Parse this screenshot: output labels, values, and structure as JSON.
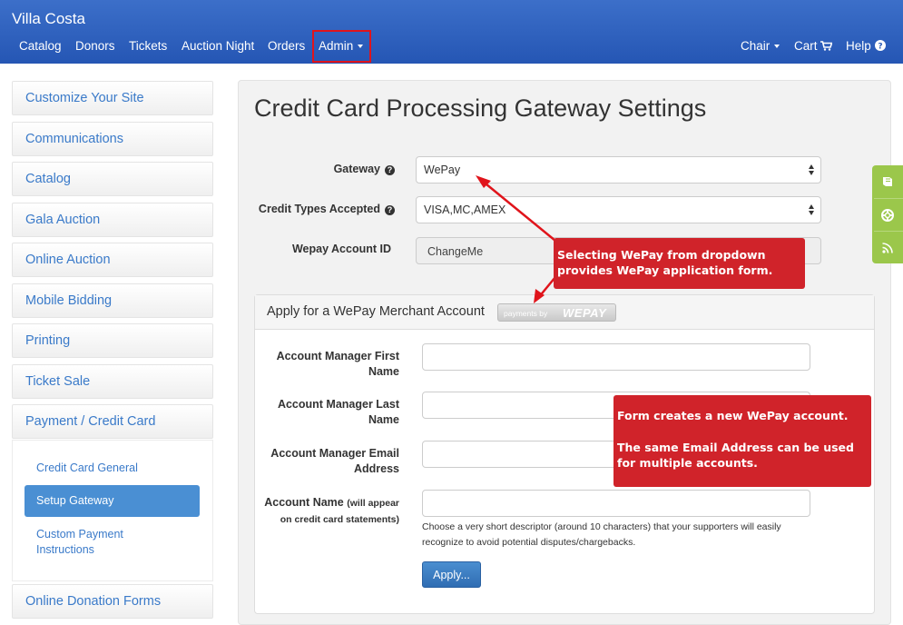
{
  "navbar": {
    "brand": "Villa Costa",
    "left_items": [
      "Catalog",
      "Donors",
      "Tickets",
      "Auction Night",
      "Orders",
      "Admin"
    ],
    "right_items": [
      "Chair",
      "Cart",
      "Help"
    ],
    "highlighted_item": "Admin",
    "colors": {
      "bar": "#2a5cb8",
      "highlight_box": "#e0141b"
    }
  },
  "sidebar": {
    "items": [
      "Customize Your Site",
      "Communications",
      "Catalog",
      "Gala Auction",
      "Online Auction",
      "Mobile Bidding",
      "Printing",
      "Ticket Sale",
      "Payment / Credit Card"
    ],
    "subitems": [
      "Credit Card General",
      "Setup Gateway",
      "Custom Payment Instructions"
    ],
    "active_subitem": "Setup Gateway",
    "after_items": [
      "Online Donation Forms"
    ]
  },
  "main": {
    "title": "Credit Card Processing Gateway Settings",
    "gateway_label": "Gateway",
    "gateway_value": "WePay",
    "credit_types_label": "Credit Types Accepted",
    "credit_types_value": "VISA,MC,AMEX",
    "account_id_label": "Wepay Account ID",
    "account_id_value": "ChangeMe"
  },
  "wepay": {
    "panel_title": "Apply for a WePay Merchant Account",
    "badge_small": "payments by",
    "badge_logo": "WEPAY",
    "first_name_label": "Account Manager First Name",
    "last_name_label": "Account Manager Last Name",
    "email_label": "Account Manager Email Address",
    "account_name_label": "Account Name",
    "account_name_note": "(will appear on credit card statements)",
    "help_text": "Choose a very short descriptor (around 10 characters) that your supporters will easily recognize to avoid potential disputes/chargebacks.",
    "apply_button": "Apply..."
  },
  "callouts": {
    "dropdown_note": "Selecting WePay from dropdown provides WePay application form.",
    "form_note_1": "Form creates a new WePay account.",
    "form_note_2": "The same Email Address can be used for multiple accounts."
  },
  "side_tools": {
    "icons": [
      "book-icon",
      "lifebuoy-icon",
      "rss-icon"
    ],
    "color": "#9bc74b"
  },
  "icons": {
    "cart": "cart-icon",
    "help": "question-circle-icon"
  }
}
